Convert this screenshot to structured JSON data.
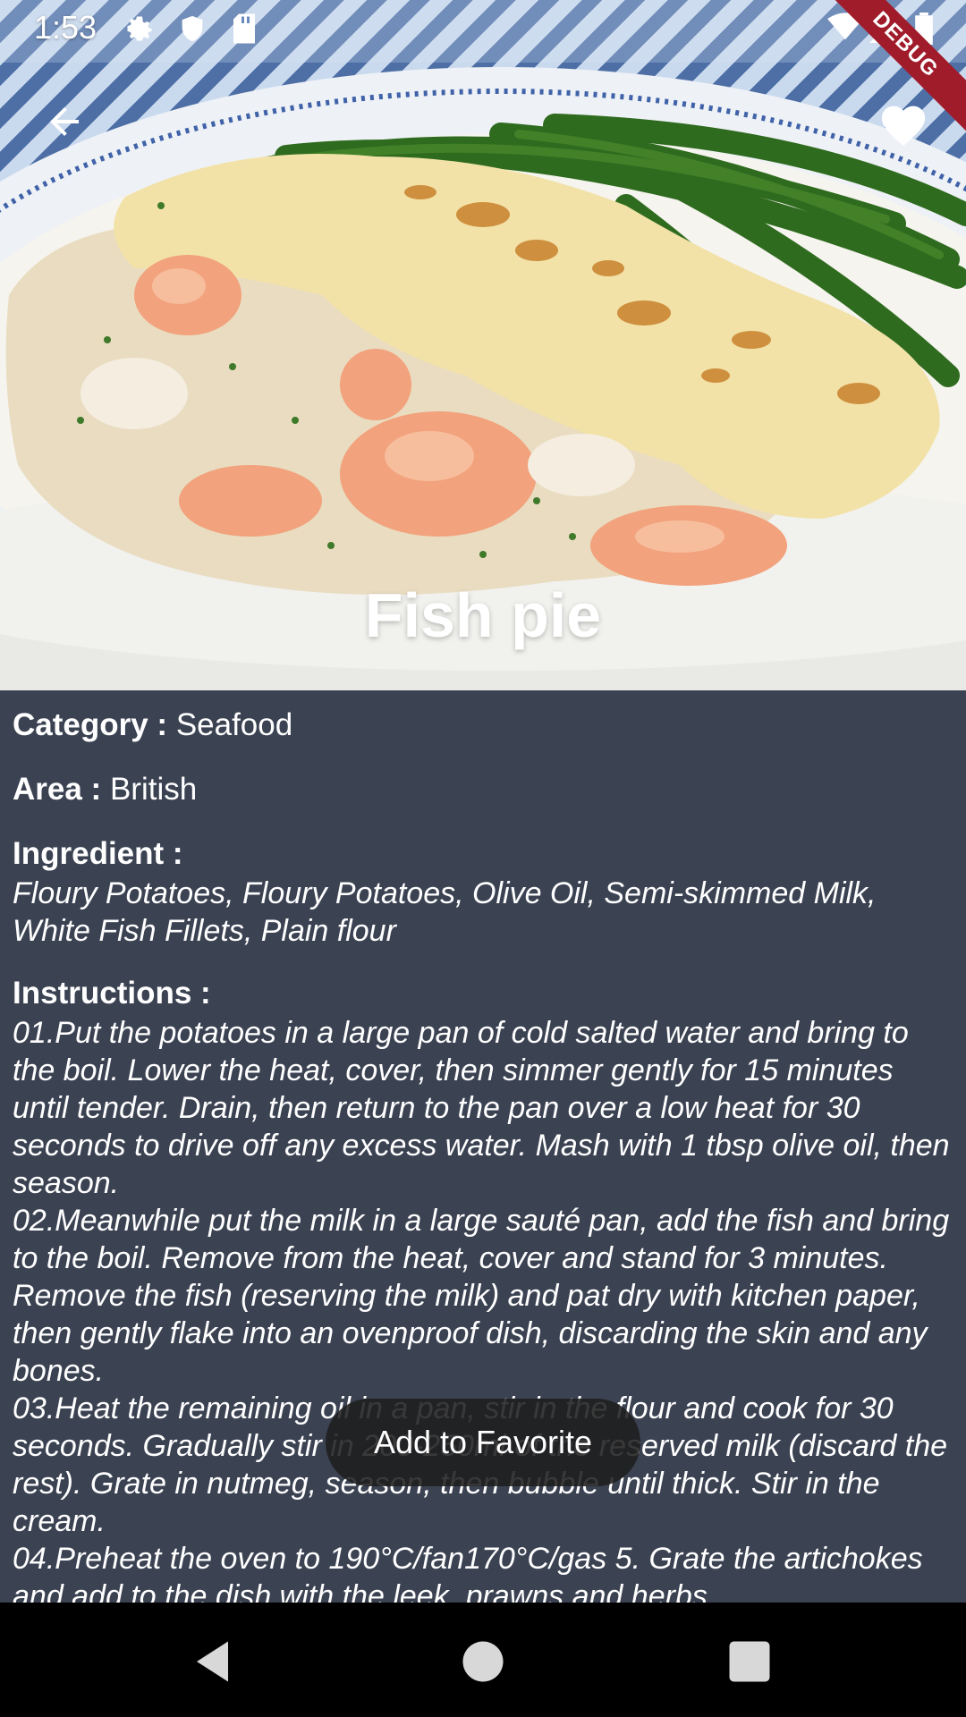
{
  "status_bar": {
    "time": "1:53",
    "icons": [
      "gear-icon",
      "shield-icon",
      "sd-card-icon",
      "wifi-icon",
      "signal-icon",
      "battery-icon"
    ]
  },
  "debug_banner": "DEBUG",
  "header": {
    "back_icon": "arrow-back-icon",
    "favorite_icon": "heart-icon"
  },
  "recipe": {
    "title": "Fish pie",
    "category_label": "Category : ",
    "category": "Seafood",
    "area_label": "Area : ",
    "area": "British",
    "ingredient_label": "Ingredient :",
    "ingredients": "Floury Potatoes, Floury Potatoes, Olive Oil, Semi-skimmed Milk, White Fish Fillets, Plain flour",
    "instructions_label": "Instructions :",
    "instructions": [
      "01.Put the potatoes in a large pan of cold salted water and bring to the boil. Lower the heat, cover, then simmer gently for 15 minutes until tender. Drain, then return to the pan over a low heat for 30 seconds to drive off any excess water. Mash with 1 tbsp olive oil, then season.",
      "02.Meanwhile put the milk in a large sauté pan, add the fish and bring to the boil. Remove from the heat, cover and stand for 3 minutes. Remove the fish (reserving the milk) and pat dry with kitchen paper, then gently flake into an ovenproof dish, discarding the skin and any bones.",
      "03.Heat the remaining oil in a pan, stir in the flour and cook for 30 seconds. Gradually stir in 200-250ml of the reserved milk (discard the rest). Grate in nutmeg, season, then bubble until thick. Stir in the cream.",
      "04.Preheat the oven to 190°C/fan170°C/gas 5. Grate the artichokes and add to the dish with the leek, prawns and herbs."
    ]
  },
  "toast": "Add to Favorite",
  "nav_bar": {
    "back_icon": "nav-back-triangle-icon",
    "home_icon": "nav-home-circle-icon",
    "recents_icon": "nav-recents-square-icon"
  },
  "colors": {
    "detail_background": "#3b4252",
    "debug_banner": "#a01c2a"
  }
}
